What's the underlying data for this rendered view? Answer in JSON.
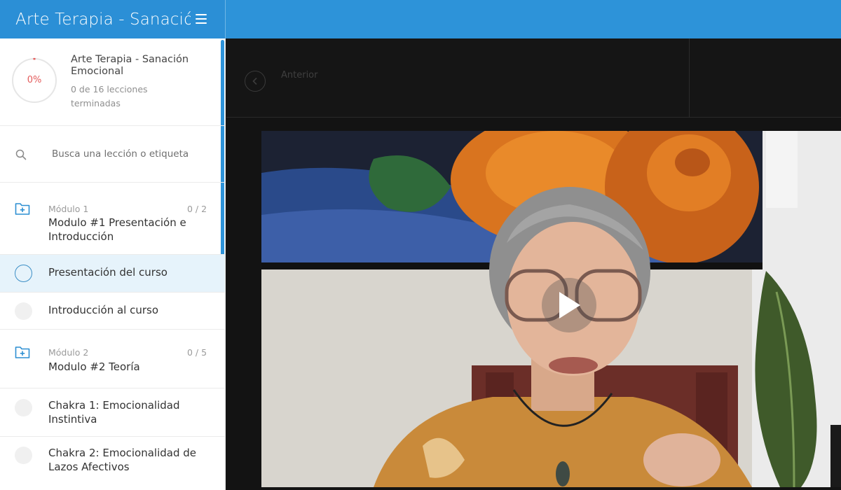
{
  "header": {
    "title": "Arte Terapia - Sanación Emocional",
    "menu_icon": "hamburger-menu-icon",
    "accent_color": "#2d93d9"
  },
  "progress": {
    "percent_label": "0%",
    "percent": 0,
    "course_title": "Arte Terapia - Sanación Emocional",
    "lessons_done": "0 de 16 lecciones terminadas"
  },
  "search": {
    "placeholder": "Busca una lección o etiqueta"
  },
  "sidebar": {
    "modules": [
      {
        "label": "Módulo 1",
        "count": "0 / 2",
        "title": "Modulo #1 Presentación e Introducción",
        "lessons": [
          {
            "title": "Presentación del curso",
            "active": true
          },
          {
            "title": "Introducción al curso",
            "active": false
          }
        ]
      },
      {
        "label": "Módulo 2",
        "count": "0 / 5",
        "title": "Modulo #2 Teoría",
        "lessons": [
          {
            "title": "Chakra 1: Emocionalidad Instintiva",
            "active": false
          },
          {
            "title": "Chakra 2: Emocionalidad de Lazos Afectivos",
            "active": false
          }
        ]
      }
    ]
  },
  "navigation": {
    "prev_label": "Anterior"
  },
  "video": {
    "play_icon": "play-icon"
  }
}
